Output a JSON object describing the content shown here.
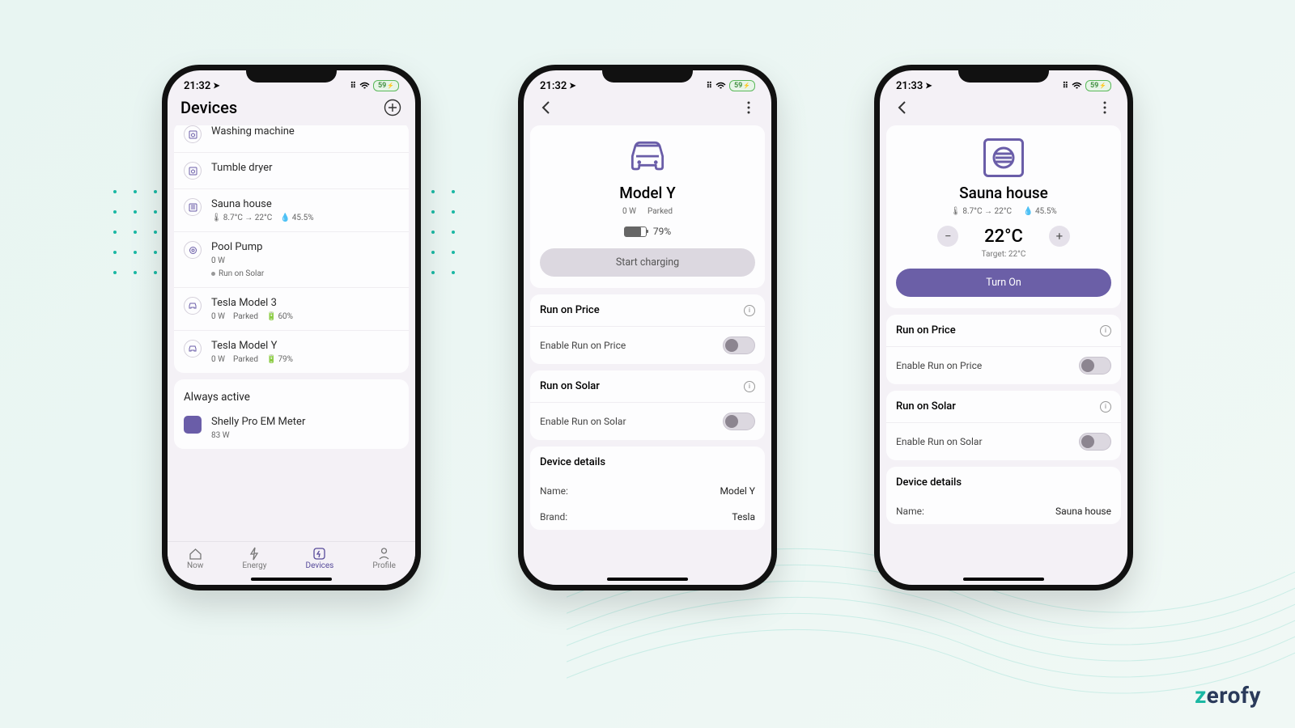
{
  "brand": "zerofy",
  "status": {
    "time1": "21:32",
    "time2": "21:32",
    "time3": "21:33",
    "battery": "59"
  },
  "screen1": {
    "title": "Devices",
    "devices": [
      {
        "name": "Washing machine"
      },
      {
        "name": "Tumble dryer"
      },
      {
        "name": "Sauna house",
        "temp": "8.7°C → 22°C",
        "humidity": "45.5%"
      },
      {
        "name": "Pool Pump",
        "power": "0 W",
        "mode": "Run on Solar"
      },
      {
        "name": "Tesla Model 3",
        "power": "0 W",
        "status": "Parked",
        "battery": "60%"
      },
      {
        "name": "Tesla Model Y",
        "power": "0 W",
        "status": "Parked",
        "battery": "79%"
      }
    ],
    "always_active_head": "Always active",
    "meters": [
      {
        "name": "Shelly Pro EM Meter",
        "power": "83 W"
      }
    ],
    "tabs": {
      "now": "Now",
      "energy": "Energy",
      "devices": "Devices",
      "profile": "Profile"
    }
  },
  "screen2": {
    "title": "Model Y",
    "power": "0 W",
    "status": "Parked",
    "battery_pct": "79%",
    "battery_fill": 79,
    "start_btn": "Start charging",
    "run_price_head": "Run on Price",
    "enable_price": "Enable Run on Price",
    "run_solar_head": "Run on Solar",
    "enable_solar": "Enable Run on Solar",
    "details_head": "Device details",
    "name_k": "Name:",
    "name_v": "Model Y",
    "brand_k": "Brand:",
    "brand_v": "Tesla"
  },
  "screen3": {
    "title": "Sauna house",
    "temp": "8.7°C → 22°C",
    "humidity": "45.5%",
    "curr_temp": "22°C",
    "target_label": "Target: 22°C",
    "turn_on": "Turn On",
    "run_price_head": "Run on Price",
    "enable_price": "Enable Run on Price",
    "run_solar_head": "Run on Solar",
    "enable_solar": "Enable Run on Solar",
    "details_head": "Device details",
    "name_k": "Name:",
    "name_v": "Sauna house"
  }
}
